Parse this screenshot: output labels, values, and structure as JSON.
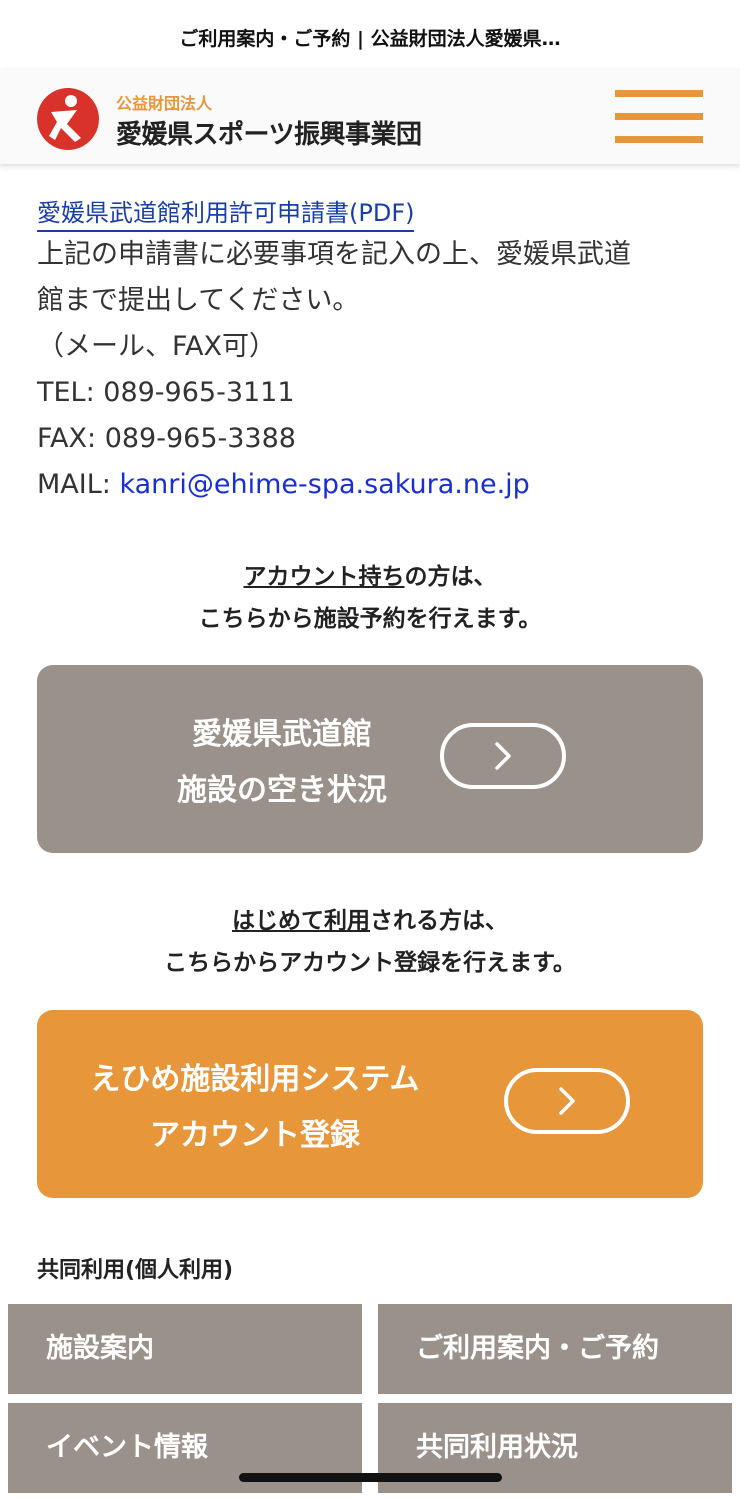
{
  "browser": {
    "title": "ご利用案内・ご予約 | 公益財団法人愛媛県…"
  },
  "header": {
    "logo_sub": "公益財団法人",
    "logo_main": "愛媛県スポーツ振興事業団",
    "brand_orange": "#e8963a"
  },
  "content": {
    "pdf_link": "愛媛県武道館利用許可申請書(PDF)",
    "lines": [
      "上記の申請書に必要事項を記入の上、愛媛県武道",
      "館まで提出してください。",
      "（メール、FAX可）",
      "TEL: 089-965-3111",
      "FAX: 089-965-3388"
    ],
    "mail_label": "MAIL: ",
    "mail_address": "kanri@ehime-spa.sakura.ne.jp"
  },
  "account_section": {
    "underlined": "アカウント持ち",
    "rest": "の方は、",
    "line2": "こちらから施設予約を行えます。"
  },
  "availability_button": {
    "line1": "愛媛県武道館",
    "line2": "施設の空き状況",
    "color": "#9a918a"
  },
  "first_time_section": {
    "underlined": "はじめて利用",
    "rest": "される方は、",
    "line2": "こちらからアカウント登録を行えます。"
  },
  "register_button": {
    "line1": "えひめ施設利用システム",
    "line2": "アカウント登録",
    "color": "#e8963a"
  },
  "section_heading": "共同利用(個人利用)",
  "bottom_nav": {
    "facility": "施設案内",
    "guide": "ご利用案内・ご予約",
    "events": "イベント情報",
    "shared_status": "共同利用状況"
  }
}
